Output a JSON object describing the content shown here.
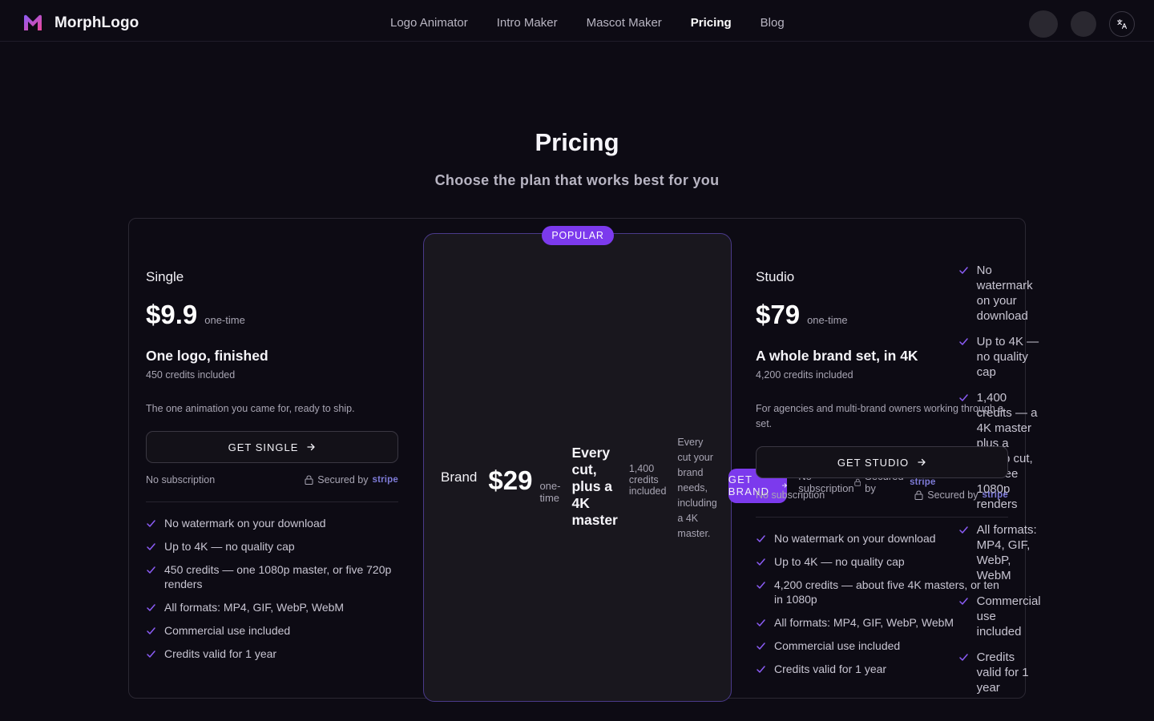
{
  "header": {
    "brand_name": "MorphLogo",
    "nav": [
      {
        "label": "Logo Animator",
        "active": false
      },
      {
        "label": "Intro Maker",
        "active": false
      },
      {
        "label": "Mascot Maker",
        "active": false
      },
      {
        "label": "Pricing",
        "active": true
      },
      {
        "label": "Blog",
        "active": false
      }
    ],
    "icons": [
      "user-avatar-icon",
      "account-icon",
      "translate-icon"
    ]
  },
  "page": {
    "title": "Pricing",
    "subtitle": "Choose the plan that works best for you"
  },
  "colors": {
    "background": "#0d0b14",
    "accent": "#7c3aed",
    "stripe": "#7e7bd8"
  },
  "plans": [
    {
      "name": "Single",
      "price": "$9.9",
      "price_unit": "one-time",
      "tagline": "One logo, finished",
      "credits": "450 credits included",
      "description": "The one animation you came for, ready to ship.",
      "cta": "GET SINGLE",
      "no_subscription": "No subscription",
      "secured_by": "Secured by",
      "stripe": "stripe",
      "features": [
        "No watermark on your download",
        "Up to 4K — no quality cap",
        "450 credits — one 1080p master, or five 720p renders",
        "All formats: MP4, GIF, WebP, WebM",
        "Commercial use included",
        "Credits valid for 1 year"
      ]
    },
    {
      "badge": "POPULAR",
      "name": "Brand",
      "price": "$29",
      "price_unit": "one-time",
      "tagline": "Every cut, plus a 4K master",
      "credits": "1,400 credits included",
      "description": "Every cut your brand needs, including a 4K master.",
      "cta": "GET BRAND",
      "no_subscription": "No subscription",
      "secured_by": "Secured by",
      "stripe": "stripe",
      "features": [
        "No watermark on your download",
        "Up to 4K — no quality cap",
        "1,400 credits — a 4K master plus a 1080p cut, or three 1080p renders",
        "All formats: MP4, GIF, WebP, WebM",
        "Commercial use included",
        "Credits valid for 1 year"
      ]
    },
    {
      "name": "Studio",
      "price": "$79",
      "price_unit": "one-time",
      "tagline": "A whole brand set, in 4K",
      "credits": "4,200 credits included",
      "description": "For agencies and multi-brand owners working through a set.",
      "cta": "GET STUDIO",
      "no_subscription": "No subscription",
      "secured_by": "Secured by",
      "stripe": "stripe",
      "features": [
        "No watermark on your download",
        "Up to 4K — no quality cap",
        "4,200 credits — about five 4K masters, or ten in 1080p",
        "All formats: MP4, GIF, WebP, WebM",
        "Commercial use included",
        "Credits valid for 1 year"
      ]
    }
  ]
}
